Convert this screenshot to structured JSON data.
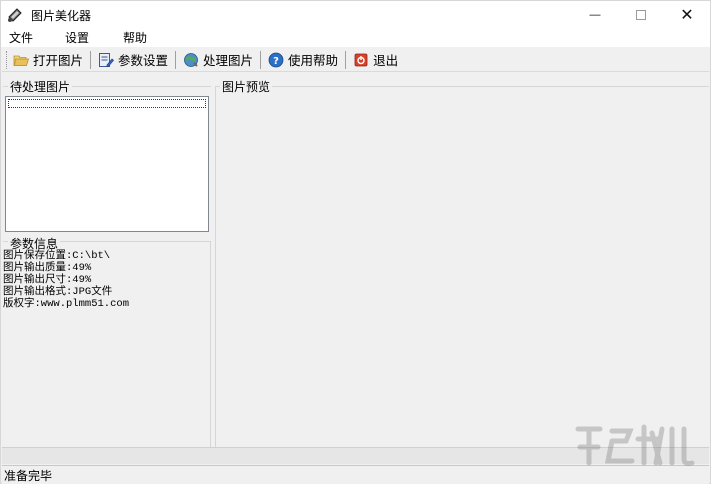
{
  "window": {
    "title": "图片美化器"
  },
  "titlebar": {
    "minimize_glyph": "—",
    "close_glyph": "✕"
  },
  "menu": {
    "items": [
      "文件",
      "设置",
      "帮助"
    ]
  },
  "toolbar": {
    "buttons": [
      {
        "label": "打开图片",
        "icon": "folder-open-icon"
      },
      {
        "label": "参数设置",
        "icon": "settings-edit-icon"
      },
      {
        "label": "处理图片",
        "icon": "process-image-icon"
      },
      {
        "label": "使用帮助",
        "icon": "help-icon"
      },
      {
        "label": "退出",
        "icon": "exit-icon"
      }
    ]
  },
  "pending": {
    "label": "待处理图片"
  },
  "params": {
    "label": "参数信息",
    "lines": [
      "图片保存位置:C:\\bt\\",
      "图片输出质量:49%",
      "图片输出尺寸:49%",
      "图片输出格式:JPG文件",
      "版权字:www.plmm51.com"
    ]
  },
  "preview": {
    "label": "图片预览"
  },
  "status": {
    "text": "准备完毕"
  },
  "colors": {
    "background": "#f0f0f0",
    "titlebar": "#ffffff",
    "listbox": "#ffffff",
    "exit_icon": "#d9412b",
    "help_icon": "#2b6fc6",
    "folder_icon": "#e8c15a"
  }
}
